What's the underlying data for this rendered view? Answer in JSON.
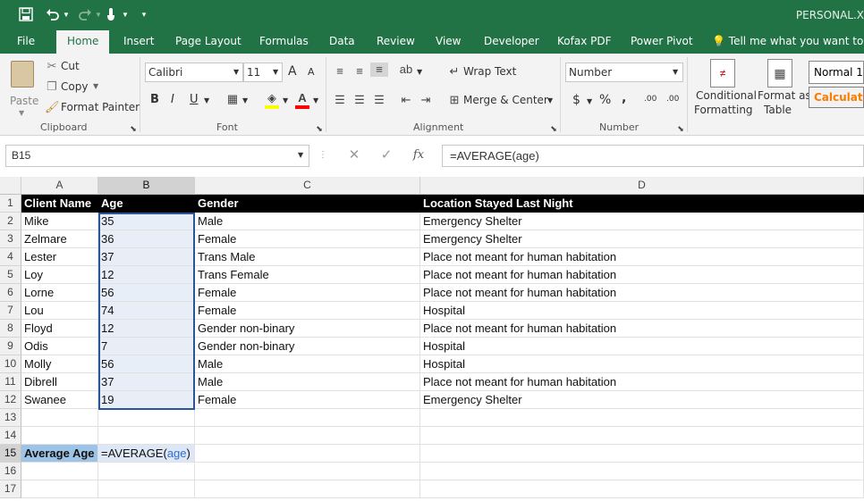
{
  "window": {
    "title": "PERSONAL.X"
  },
  "ribbon_tabs": [
    {
      "label": "File"
    },
    {
      "label": "Home"
    },
    {
      "label": "Insert"
    },
    {
      "label": "Page Layout"
    },
    {
      "label": "Formulas"
    },
    {
      "label": "Data"
    },
    {
      "label": "Review"
    },
    {
      "label": "View"
    },
    {
      "label": "Developer"
    },
    {
      "label": "Kofax PDF"
    },
    {
      "label": "Power Pivot"
    }
  ],
  "tell_me": {
    "placeholder": "Tell me what you want to do"
  },
  "clipboard": {
    "paste": "Paste",
    "cut": "Cut",
    "copy": "Copy",
    "format_painter": "Format Painter",
    "group_label": "Clipboard"
  },
  "font": {
    "name": "Calibri",
    "size": "11",
    "group_label": "Font",
    "bold": "B",
    "italic": "I",
    "underline": "U",
    "grow": "A",
    "shrink": "A"
  },
  "alignment": {
    "wrap_text": "Wrap Text",
    "merge_center": "Merge & Center",
    "group_label": "Alignment"
  },
  "number": {
    "format": "Number",
    "currency": "$",
    "percent": "%",
    "comma": ",",
    "inc_decimal": ".00",
    "dec_decimal": ".00",
    "group_label": "Number"
  },
  "styles": {
    "conditional_formatting_l1": "Conditional",
    "conditional_formatting_l2": "Formatting",
    "format_table_l1": "Format as",
    "format_table_l2": "Table",
    "style_normal": "Normal 1",
    "style_calculation": "Calculatio"
  },
  "formula_bar": {
    "name_box": "B15",
    "fx": "fx",
    "formula": "=AVERAGE(age)"
  },
  "columns": [
    "A",
    "B",
    "C",
    "D"
  ],
  "rows": [
    {
      "num": "1",
      "a": "Client Name",
      "b": "Age",
      "c": "Gender",
      "d": "Location Stayed Last Night"
    },
    {
      "num": "2",
      "a": "Mike",
      "b": "35",
      "c": "Male",
      "d": "Emergency Shelter"
    },
    {
      "num": "3",
      "a": "Zelmare",
      "b": "36",
      "c": "Female",
      "d": "Emergency Shelter"
    },
    {
      "num": "4",
      "a": "Lester",
      "b": "37",
      "c": "Trans Male",
      "d": "Place not meant for human habitation"
    },
    {
      "num": "5",
      "a": "Loy",
      "b": "12",
      "c": "Trans Female",
      "d": "Place not meant for human habitation"
    },
    {
      "num": "6",
      "a": "Lorne",
      "b": "56",
      "c": "Female",
      "d": "Place not meant for human habitation"
    },
    {
      "num": "7",
      "a": "Lou",
      "b": "74",
      "c": "Female",
      "d": "Hospital"
    },
    {
      "num": "8",
      "a": "Floyd",
      "b": "12",
      "c": "Gender non-binary",
      "d": "Place not meant for human habitation"
    },
    {
      "num": "9",
      "a": "Odis",
      "b": "7",
      "c": "Gender non-binary",
      "d": "Hospital"
    },
    {
      "num": "10",
      "a": "Molly",
      "b": "56",
      "c": "Male",
      "d": "Hospital"
    },
    {
      "num": "11",
      "a": "Dibrell",
      "b": "37",
      "c": "Male",
      "d": "Place not meant for human habitation"
    },
    {
      "num": "12",
      "a": "Swanee",
      "b": "19",
      "c": "Female",
      "d": "Emergency Shelter"
    },
    {
      "num": "13",
      "a": "",
      "b": "",
      "c": "",
      "d": ""
    },
    {
      "num": "14",
      "a": "",
      "b": "",
      "c": "",
      "d": ""
    },
    {
      "num": "15",
      "a": "Average Age",
      "b_prefix": "=AVERAGE(",
      "b_ref": "age",
      "b_suffix": ")",
      "c": "",
      "d": ""
    },
    {
      "num": "16",
      "a": "",
      "b": "",
      "c": "",
      "d": ""
    },
    {
      "num": "17",
      "a": "",
      "b": "",
      "c": "",
      "d": ""
    }
  ],
  "colors": {
    "excel_green": "#217346",
    "selection_border": "#2a5597",
    "average_label_fill": "#9dc3e6",
    "range_ref": "#2f6fd0"
  },
  "icons": [
    "save-icon",
    "undo-icon",
    "redo-icon",
    "touch-mode-icon",
    "customize-qat-icon",
    "lightbulb-icon",
    "scissors-icon",
    "copy-icon",
    "format-painter-icon"
  ]
}
